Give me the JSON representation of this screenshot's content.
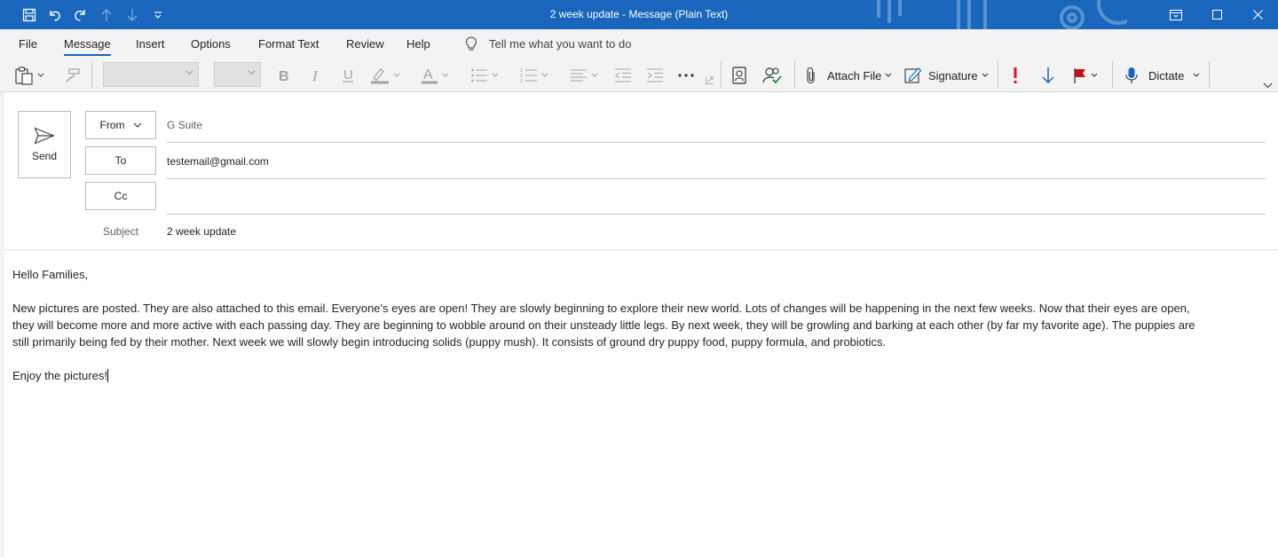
{
  "window": {
    "title": "2 week update  -  Message (Plain Text)"
  },
  "menu": {
    "tabs": [
      "File",
      "Message",
      "Insert",
      "Options",
      "Format Text",
      "Review",
      "Help"
    ],
    "active": "Message",
    "tell_me": "Tell me what you want to do"
  },
  "ribbon": {
    "attach_file": "Attach File",
    "signature": "Signature",
    "dictate": "Dictate"
  },
  "compose": {
    "send_label": "Send",
    "from_label": "From",
    "from_value": "G Suite",
    "to_label": "To",
    "to_value": "testemail@gmail.com",
    "cc_label": "Cc",
    "cc_value": "",
    "subject_label": "Subject",
    "subject_value": "2 week update"
  },
  "body": {
    "greeting": "Hello Families,",
    "paragraph_line1": "New pictures are posted.  They are also attached to this email.  Everyone's eyes are open!  They are slowly beginning to explore their new world.  Lots of changes will be happening in the next few weeks. Now that their eyes are open,",
    "paragraph_line2": "they will become more and more active with each passing day.  They are beginning to wobble around on their unsteady little legs. By next week, they will be growling and barking at each other (by far my favorite age). The puppies are",
    "paragraph_line3": "still primarily being fed by their mother. Next week we will slowly begin introducing solids (puppy mush).  It consists of ground dry puppy food, puppy formula, and probiotics.",
    "closing": "Enjoy the pictures!"
  },
  "colors": {
    "titlebar": "#1a66bd",
    "ribbon": "#f3f3f3",
    "importance_high": "#e81123",
    "importance_low": "#1a66bd",
    "flag": "#c50f1f"
  }
}
